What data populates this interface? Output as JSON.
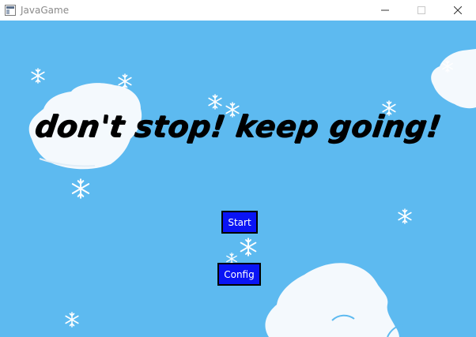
{
  "window": {
    "title": "JavaGame",
    "icon": "java-app-icon",
    "controls": {
      "minimize_icon": "minimize-icon",
      "maximize_icon": "maximize-icon",
      "close_icon": "close-icon"
    }
  },
  "game": {
    "background_color": "#5dbaf0",
    "headline": "don't stop! keep going!",
    "buttons": {
      "start_label": "Start",
      "config_label": "Config",
      "color": "#0a14f5"
    },
    "decorations": {
      "cloud_icon": "cloud-icon",
      "snowflake_icon": "snowflake-icon"
    }
  }
}
